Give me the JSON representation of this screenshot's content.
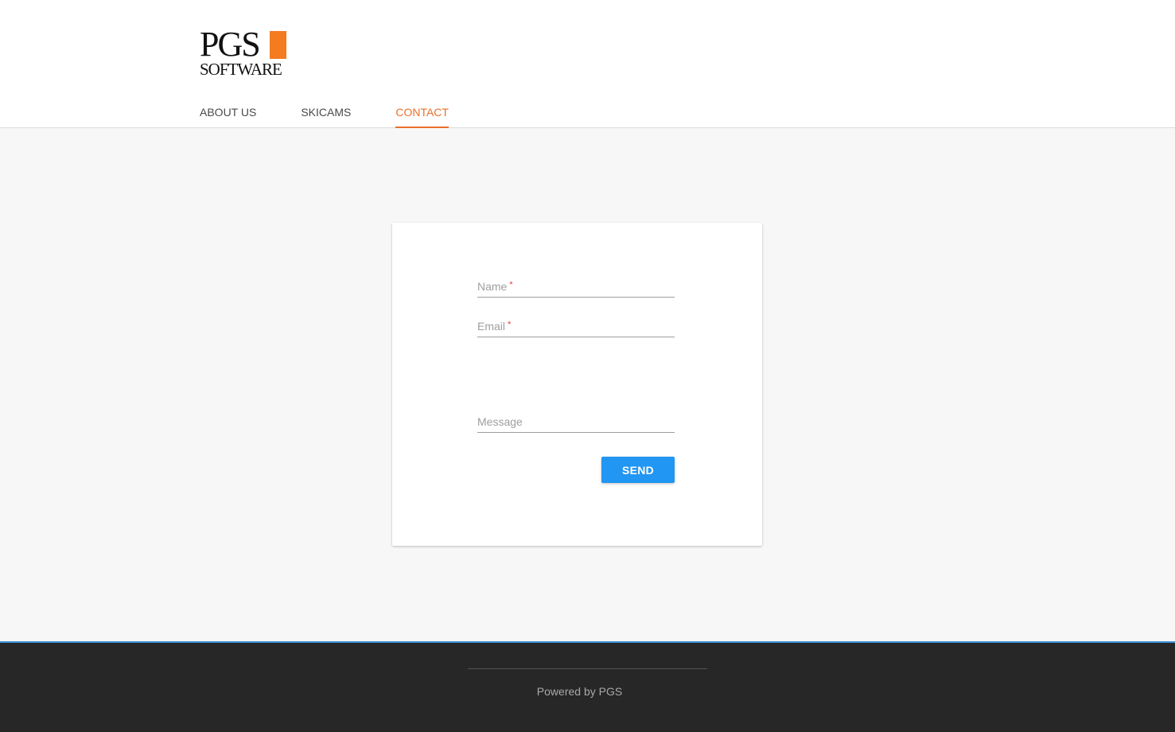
{
  "logo": {
    "line1": "PGS",
    "line2": "SOFTWARE",
    "accent_color": "#f47b20"
  },
  "nav": {
    "items": [
      {
        "label": "ABOUT US"
      },
      {
        "label": "SKICAMS"
      },
      {
        "label": "CONTACT",
        "active": true
      }
    ],
    "active_color": "#e8702a"
  },
  "form": {
    "name_label": "Name",
    "email_label": "Email",
    "message_label": "Message",
    "required_marker": "*",
    "send_label": "SEND",
    "button_color": "#2196f3"
  },
  "footer": {
    "text": "Powered by PGS"
  }
}
